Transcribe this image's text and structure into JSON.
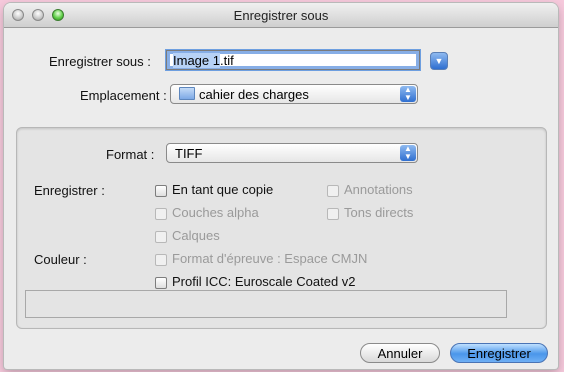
{
  "window": {
    "title": "Enregistrer sous"
  },
  "save_as": {
    "label": "Enregistrer sous :",
    "value_selected": "Image 1",
    "value_rest": ".tif"
  },
  "location": {
    "label": "Emplacement :",
    "value": "cahier des charges",
    "icon": "folder-icon"
  },
  "format": {
    "label": "Format :",
    "value": "TIFF"
  },
  "save_section": {
    "label": "Enregistrer :",
    "options": {
      "copy": "En tant que copie",
      "annotations": "Annotations",
      "alpha": "Couches alpha",
      "spot": "Tons directs",
      "layers": "Calques"
    }
  },
  "color_section": {
    "label": "Couleur :",
    "proof": "Format d'épreuve : Espace CMJN",
    "icc": "Profil ICC:  Euroscale Coated v2"
  },
  "buttons": {
    "cancel": "Annuler",
    "save": "Enregistrer"
  },
  "colors": {
    "accent": "#3b86e6",
    "background": "#f6c9dc"
  }
}
